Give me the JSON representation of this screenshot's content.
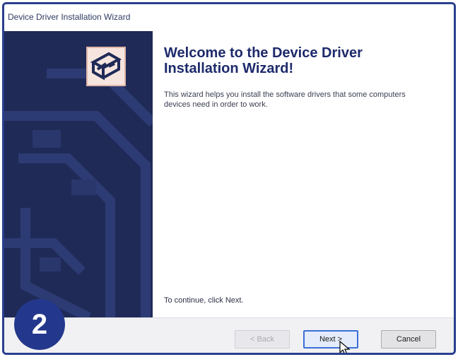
{
  "window": {
    "title": "Device Driver Installation Wizard"
  },
  "content": {
    "heading": "Welcome to the Device Driver Installation Wizard!",
    "description": "This wizard helps you install the software drivers that some computers devices need in order to work.",
    "continue_text": "To continue, click Next."
  },
  "buttons": {
    "back_label": "< Back",
    "next_label": "Next >",
    "cancel_label": "Cancel"
  },
  "step_badge": {
    "number": "2"
  },
  "colors": {
    "sidebar": "#1f2a57",
    "frame": "#2a3f8f",
    "badge": "#23388c",
    "heading": "#1d2a6b"
  }
}
